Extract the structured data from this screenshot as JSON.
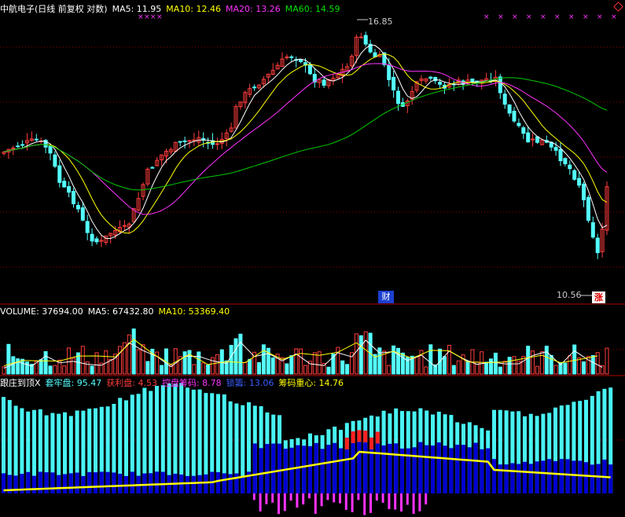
{
  "main": {
    "title": "中航电子(日线 前复权 对数)",
    "ma5": "MA5: 11.95",
    "ma10": "MA10: 12.46",
    "ma20": "MA20: 13.26",
    "ma60": "MA60: 14.59",
    "high_label": "16.85",
    "low_label": "10.56",
    "fin_badge": "财",
    "limit_badge": "涨"
  },
  "volume": {
    "label": "VOLUME: 37694.00",
    "ma5": "MA5: 67432.80",
    "ma10": "MA10: 53369.40"
  },
  "indicator": {
    "name": "跟庄到顶",
    "close_mark": "X",
    "trapped": "套牢盘: 95.47",
    "profit": "获利盘: 4.53",
    "control": "控盘筹码: 8.78",
    "lock": "锁籌: 13.06",
    "center": "筹码重心: 14.76"
  },
  "colors": {
    "bg": "#000000",
    "up": "#ff3c3c",
    "down": "#54ffff",
    "ma5": "#ffffff",
    "ma10": "#ffff00",
    "ma20": "#ff33ff",
    "ma60": "#00c800",
    "grid": "#8b0000",
    "blue": "#0000d0",
    "yellow": "#ffff00",
    "magenta": "#ff33ff"
  }
}
